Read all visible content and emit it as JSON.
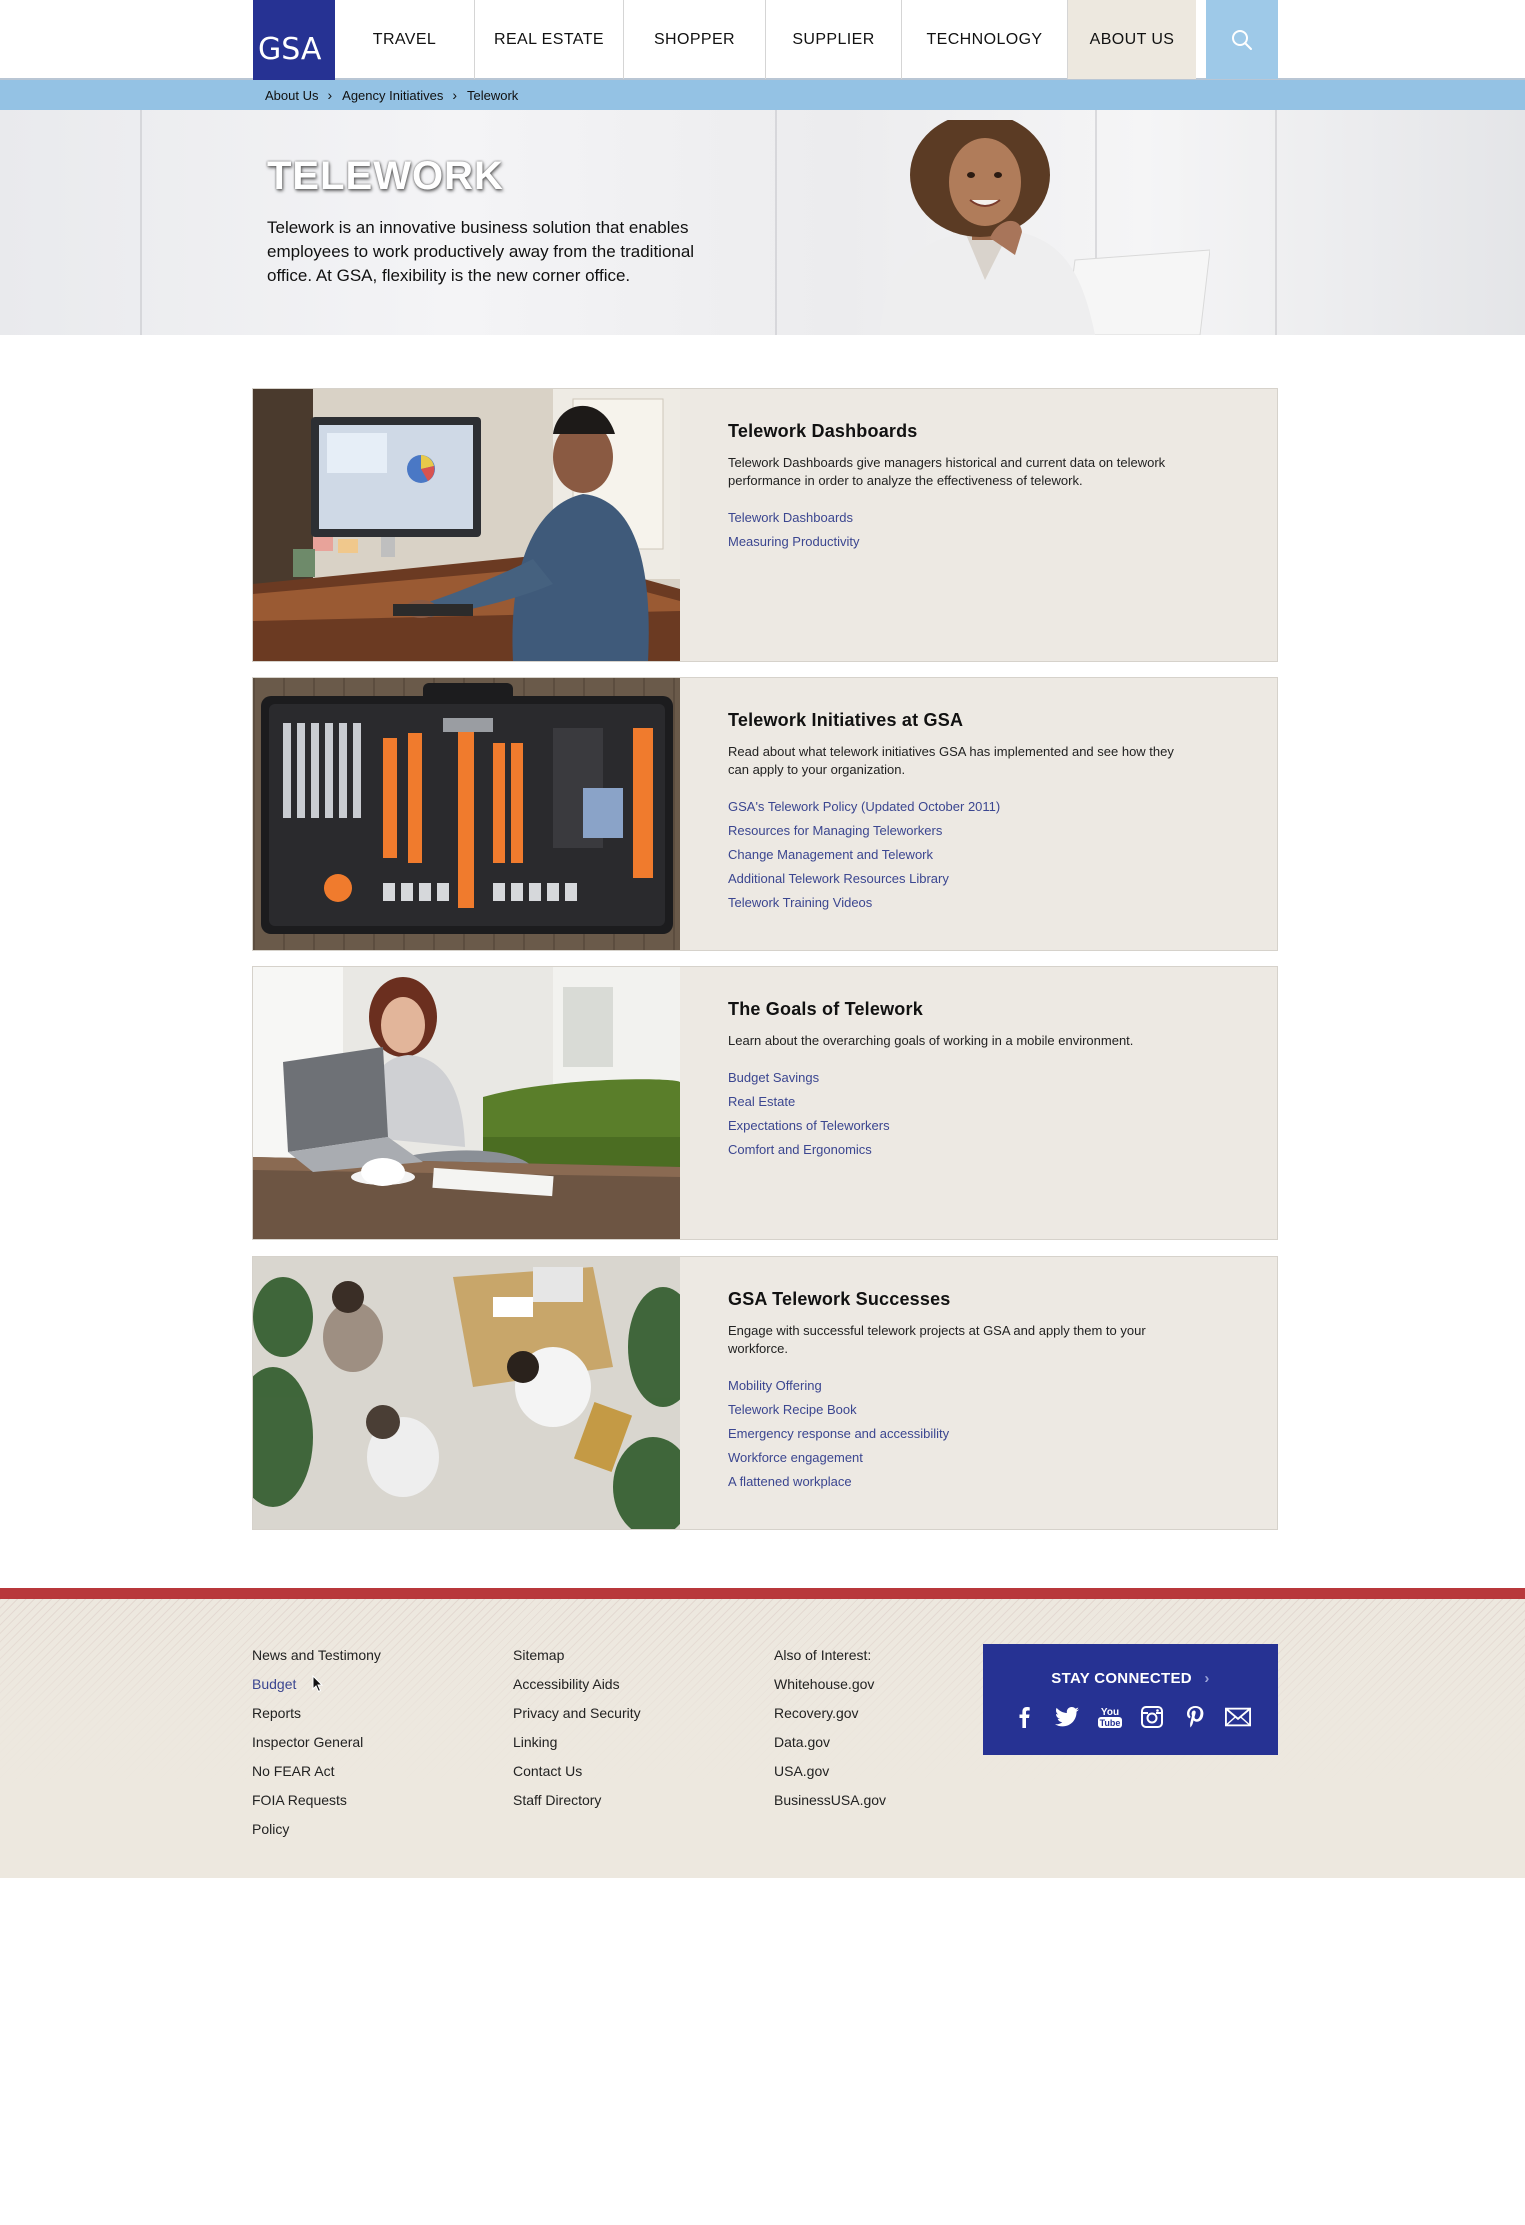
{
  "header": {
    "logo_text": "GSA",
    "nav": [
      {
        "label": "TRAVEL"
      },
      {
        "label": "REAL ESTATE"
      },
      {
        "label": "SHOPPER"
      },
      {
        "label": "SUPPLIER"
      },
      {
        "label": "TECHNOLOGY"
      },
      {
        "label": "ABOUT US",
        "active": true
      }
    ],
    "search_icon": "search-icon"
  },
  "breadcrumb": [
    "About Us",
    "Agency Initiatives",
    "Telework"
  ],
  "hero": {
    "title": "TELEWORK",
    "text": "Telework is an innovative business solution that enables employees to work productively away from the traditional office. At GSA, flexibility is the new corner office."
  },
  "cards": [
    {
      "title": "Telework Dashboards",
      "desc": "Telework Dashboards give managers historical and current data on telework performance in order to analyze the effectiveness of telework.",
      "links": [
        "Telework Dashboards",
        "Measuring Productivity"
      ]
    },
    {
      "title": "Telework Initiatives at GSA",
      "desc": "Read about what telework initiatives GSA has implemented and see how they can apply to your organization.",
      "links": [
        "GSA's Telework Policy (Updated October 2011)",
        "Resources for Managing Teleworkers",
        "Change Management and Telework",
        "Additional Telework Resources Library",
        "Telework Training Videos"
      ]
    },
    {
      "title": "The Goals of Telework",
      "desc": "Learn about the overarching goals of working in a mobile environment.",
      "links": [
        "Budget Savings",
        "Real Estate",
        "Expectations of Teleworkers",
        "Comfort and Ergonomics"
      ]
    },
    {
      "title": "GSA Telework Successes",
      "desc": "Engage with successful telework projects at GSA and apply them to your workforce.",
      "links": [
        "Mobility Offering",
        "Telework Recipe Book",
        "Emergency response and accessibility",
        "Workforce engagement",
        "A flattened workplace"
      ]
    }
  ],
  "footer": {
    "col1": [
      "News and Testimony",
      "Budget",
      "Reports",
      "Inspector General",
      "No FEAR Act",
      "FOIA Requests",
      "Policy"
    ],
    "col2": [
      "Sitemap",
      "Accessibility Aids",
      "Privacy and Security",
      "Linking",
      "Contact Us",
      "Staff Directory"
    ],
    "col3_heading": "Also of Interest:",
    "col3": [
      "Whitehouse.gov",
      "Recovery.gov",
      "Data.gov",
      "USA.gov",
      "BusinessUSA.gov"
    ],
    "stay_connected": "STAY CONNECTED",
    "social": [
      "facebook-icon",
      "twitter-icon",
      "youtube-icon",
      "instagram-icon",
      "pinterest-icon",
      "email-icon"
    ]
  },
  "colors": {
    "brand_blue": "#263293",
    "breadcrumb_blue": "#94c2e4",
    "search_blue": "#9ec9e8",
    "card_bg": "#ede9e3",
    "link": "#3b4690",
    "footer_red": "#b8383b"
  }
}
